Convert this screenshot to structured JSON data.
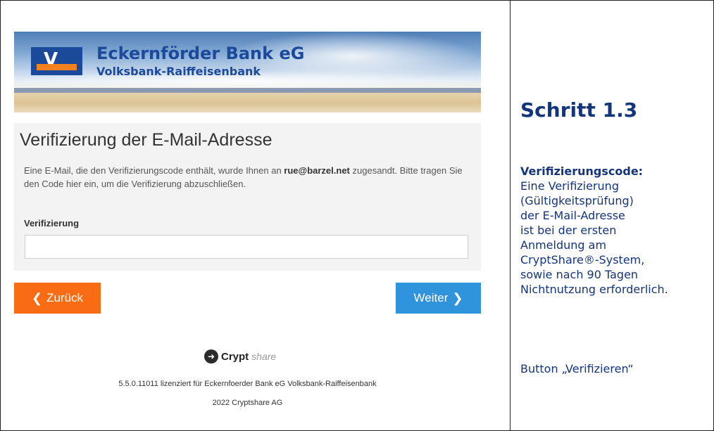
{
  "bank": {
    "name": "Eckernförder Bank eG",
    "subtitle": "Volksbank-Raiffeisenbank"
  },
  "card": {
    "title": "Verifizierung der E-Mail-Adresse",
    "description_prefix": "Eine E-Mail, die den Verifizierungscode enthält, wurde Ihnen an",
    "email": "rue@barzel.net",
    "description_suffix": "zugesandt. Bitte tragen Sie den Code hier ein, um die Verifizierung abzuschließen.",
    "field_label": "Verifizierung",
    "field_value": ""
  },
  "buttons": {
    "back": "Zurück",
    "next": "Weiter"
  },
  "footer": {
    "logo_bold": "Crypt",
    "logo_light": "share",
    "license": "5.5.0.11011 lizenziert für Eckernfoerder Bank eG Volksbank-Raiffeisenbank",
    "copyright": "2022 Cryptshare AG"
  },
  "instructions": {
    "step_title": "Schritt 1.3",
    "heading": "Verifizierungscode:",
    "lines": [
      "Eine Verifizierung",
      "(Gültigkeitsprüfung)",
      "der E-Mail-Adresse",
      "ist bei der ersten",
      "Anmeldung am",
      "CryptShare®-System,",
      "sowie nach 90 Tagen",
      "Nichtnutzung erforderlich."
    ],
    "button_note": "Button „Verifizieren“"
  },
  "colors": {
    "brand_blue": "#1c4a9b",
    "brand_orange": "#f5821f",
    "back_button": "#f96c13",
    "next_button": "#3094dc",
    "instruction_text": "#14357a"
  },
  "icons": {
    "back": "chevron-left-icon",
    "next": "chevron-right-icon",
    "cryptshare": "cryptshare-logo-icon"
  }
}
